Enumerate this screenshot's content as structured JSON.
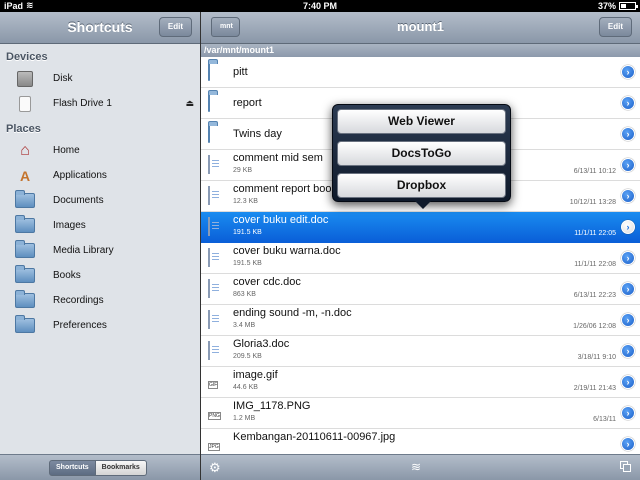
{
  "status": {
    "carrier": "iPad",
    "time": "7:40 PM",
    "battery": "37%",
    "battery_level": 0.37
  },
  "left": {
    "title": "Shortcuts",
    "edit_label": "Edit",
    "sections": {
      "devices": "Devices",
      "places": "Places"
    },
    "devices": [
      {
        "label": "Disk",
        "icon": "disk-icon"
      },
      {
        "label": "Flash Drive 1",
        "icon": "flash-drive-icon",
        "eject": "⏏"
      }
    ],
    "places": [
      {
        "label": "Home",
        "icon": "home-icon"
      },
      {
        "label": "Applications",
        "icon": "applications-icon"
      },
      {
        "label": "Documents",
        "icon": "folder-icon"
      },
      {
        "label": "Images",
        "icon": "folder-icon"
      },
      {
        "label": "Media Library",
        "icon": "folder-icon"
      },
      {
        "label": "Books",
        "icon": "folder-icon"
      },
      {
        "label": "Recordings",
        "icon": "folder-icon"
      },
      {
        "label": "Preferences",
        "icon": "folder-icon"
      }
    ],
    "toolbar": {
      "shortcuts_tab": "Shortcuts",
      "bookmarks_tab": "Bookmarks"
    }
  },
  "right": {
    "back_label": "mnt",
    "title": "mount1",
    "edit_label": "Edit",
    "path": "/var/mnt/mount1",
    "files": [
      {
        "name": "pitt",
        "type": "folder"
      },
      {
        "name": "report",
        "type": "folder"
      },
      {
        "name": "Twins day",
        "type": "folder"
      },
      {
        "name": "comment mid sem",
        "type": "doc",
        "size": "29 KB",
        "date": "6/13/11 10:12"
      },
      {
        "name": "comment report boo",
        "type": "doc",
        "size": "12.3 KB",
        "date": "10/12/11 13:28"
      },
      {
        "name": "cover buku edit.doc",
        "type": "doc",
        "size": "191.5 KB",
        "date": "11/1/11 22:05",
        "selected": true
      },
      {
        "name": "cover buku warna.doc",
        "type": "doc",
        "size": "191.5 KB",
        "date": "11/1/11 22:08"
      },
      {
        "name": "cover cdc.doc",
        "type": "doc",
        "size": "863 KB",
        "date": "6/13/11 22:23"
      },
      {
        "name": "ending sound -m, -n.doc",
        "type": "doc",
        "size": "3.4 MB",
        "date": "1/26/06 12:08"
      },
      {
        "name": "Gloria3.doc",
        "type": "doc",
        "size": "209.5 KB",
        "date": "3/18/11 9:10"
      },
      {
        "name": "image.gif",
        "type": "image",
        "badge": "GIF",
        "size": "44.6 KB",
        "date": "2/19/11 21:43"
      },
      {
        "name": "IMG_1178.PNG",
        "type": "image",
        "badge": "PNG",
        "size": "1.2 MB",
        "date": "6/13/11"
      },
      {
        "name": "Kembangan-20110611-00967.jpg",
        "type": "image",
        "badge": "JPG",
        "size": "",
        "date": ""
      }
    ],
    "popover": [
      "Web Viewer",
      "DocsToGo",
      "Dropbox"
    ]
  }
}
